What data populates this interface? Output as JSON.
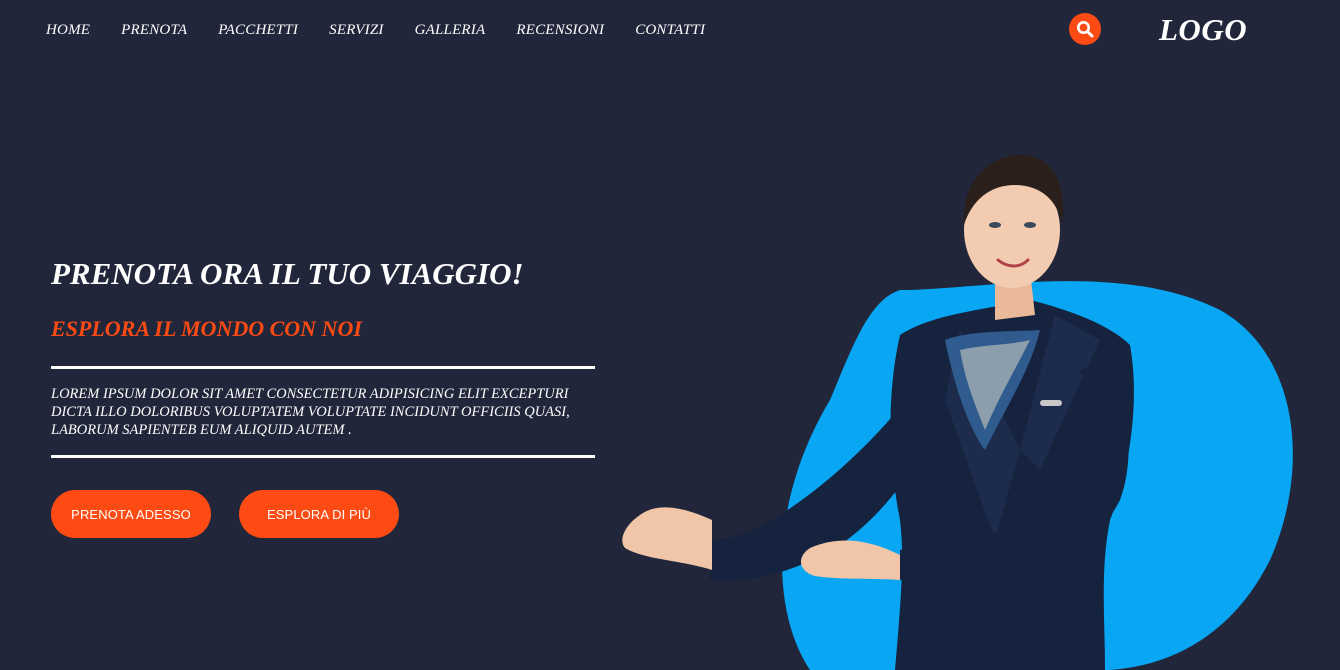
{
  "nav": {
    "items": [
      "HOME",
      "PRENOTA",
      "PACCHETTI",
      "SERVIZI",
      "GALLERIA",
      "RECENSIONI",
      "CONTATTI"
    ]
  },
  "header": {
    "logo": "LOGO",
    "search_icon": "search-icon"
  },
  "hero": {
    "title": "PRENOTA ORA IL TUO VIAGGIO!",
    "subtitle": "ESPLORA IL MONDO CON NOI",
    "body": "LOREM IPSUM DOLOR SIT AMET CONSECTETUR ADIPISICING ELIT EXCEPTURI DICTA ILLO DOLORIBUS VOLUPTATEM VOLUPTATE INCIDUNT OFFICIIS QUASI, LABORUM SAPIENTEB EUM ALIQUID AUTEM .",
    "primary_button": "PRENOTA ADESSO",
    "secondary_button": "ESPLORA DI PIÙ"
  },
  "colors": {
    "background": "#21263a",
    "accent": "#fe4a13",
    "blob": "#08a6f3",
    "text": "#ffffff"
  }
}
